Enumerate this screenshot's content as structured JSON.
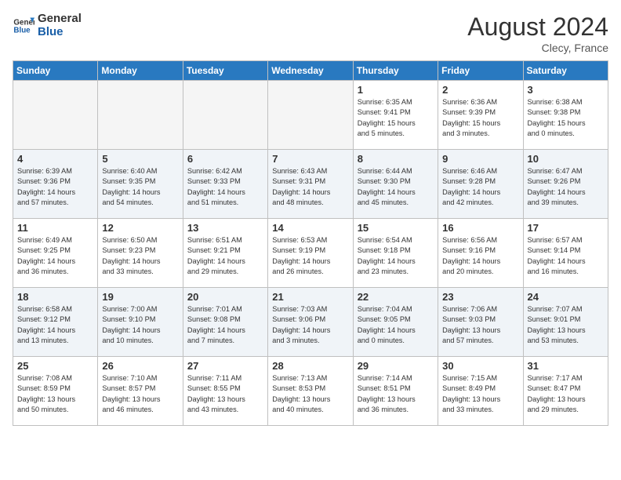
{
  "header": {
    "logo_line1": "General",
    "logo_line2": "Blue",
    "month_year": "August 2024",
    "location": "Clecy, France"
  },
  "weekdays": [
    "Sunday",
    "Monday",
    "Tuesday",
    "Wednesday",
    "Thursday",
    "Friday",
    "Saturday"
  ],
  "weeks": [
    [
      {
        "day": "",
        "info": ""
      },
      {
        "day": "",
        "info": ""
      },
      {
        "day": "",
        "info": ""
      },
      {
        "day": "",
        "info": ""
      },
      {
        "day": "1",
        "info": "Sunrise: 6:35 AM\nSunset: 9:41 PM\nDaylight: 15 hours\nand 5 minutes."
      },
      {
        "day": "2",
        "info": "Sunrise: 6:36 AM\nSunset: 9:39 PM\nDaylight: 15 hours\nand 3 minutes."
      },
      {
        "day": "3",
        "info": "Sunrise: 6:38 AM\nSunset: 9:38 PM\nDaylight: 15 hours\nand 0 minutes."
      }
    ],
    [
      {
        "day": "4",
        "info": "Sunrise: 6:39 AM\nSunset: 9:36 PM\nDaylight: 14 hours\nand 57 minutes."
      },
      {
        "day": "5",
        "info": "Sunrise: 6:40 AM\nSunset: 9:35 PM\nDaylight: 14 hours\nand 54 minutes."
      },
      {
        "day": "6",
        "info": "Sunrise: 6:42 AM\nSunset: 9:33 PM\nDaylight: 14 hours\nand 51 minutes."
      },
      {
        "day": "7",
        "info": "Sunrise: 6:43 AM\nSunset: 9:31 PM\nDaylight: 14 hours\nand 48 minutes."
      },
      {
        "day": "8",
        "info": "Sunrise: 6:44 AM\nSunset: 9:30 PM\nDaylight: 14 hours\nand 45 minutes."
      },
      {
        "day": "9",
        "info": "Sunrise: 6:46 AM\nSunset: 9:28 PM\nDaylight: 14 hours\nand 42 minutes."
      },
      {
        "day": "10",
        "info": "Sunrise: 6:47 AM\nSunset: 9:26 PM\nDaylight: 14 hours\nand 39 minutes."
      }
    ],
    [
      {
        "day": "11",
        "info": "Sunrise: 6:49 AM\nSunset: 9:25 PM\nDaylight: 14 hours\nand 36 minutes."
      },
      {
        "day": "12",
        "info": "Sunrise: 6:50 AM\nSunset: 9:23 PM\nDaylight: 14 hours\nand 33 minutes."
      },
      {
        "day": "13",
        "info": "Sunrise: 6:51 AM\nSunset: 9:21 PM\nDaylight: 14 hours\nand 29 minutes."
      },
      {
        "day": "14",
        "info": "Sunrise: 6:53 AM\nSunset: 9:19 PM\nDaylight: 14 hours\nand 26 minutes."
      },
      {
        "day": "15",
        "info": "Sunrise: 6:54 AM\nSunset: 9:18 PM\nDaylight: 14 hours\nand 23 minutes."
      },
      {
        "day": "16",
        "info": "Sunrise: 6:56 AM\nSunset: 9:16 PM\nDaylight: 14 hours\nand 20 minutes."
      },
      {
        "day": "17",
        "info": "Sunrise: 6:57 AM\nSunset: 9:14 PM\nDaylight: 14 hours\nand 16 minutes."
      }
    ],
    [
      {
        "day": "18",
        "info": "Sunrise: 6:58 AM\nSunset: 9:12 PM\nDaylight: 14 hours\nand 13 minutes."
      },
      {
        "day": "19",
        "info": "Sunrise: 7:00 AM\nSunset: 9:10 PM\nDaylight: 14 hours\nand 10 minutes."
      },
      {
        "day": "20",
        "info": "Sunrise: 7:01 AM\nSunset: 9:08 PM\nDaylight: 14 hours\nand 7 minutes."
      },
      {
        "day": "21",
        "info": "Sunrise: 7:03 AM\nSunset: 9:06 PM\nDaylight: 14 hours\nand 3 minutes."
      },
      {
        "day": "22",
        "info": "Sunrise: 7:04 AM\nSunset: 9:05 PM\nDaylight: 14 hours\nand 0 minutes."
      },
      {
        "day": "23",
        "info": "Sunrise: 7:06 AM\nSunset: 9:03 PM\nDaylight: 13 hours\nand 57 minutes."
      },
      {
        "day": "24",
        "info": "Sunrise: 7:07 AM\nSunset: 9:01 PM\nDaylight: 13 hours\nand 53 minutes."
      }
    ],
    [
      {
        "day": "25",
        "info": "Sunrise: 7:08 AM\nSunset: 8:59 PM\nDaylight: 13 hours\nand 50 minutes."
      },
      {
        "day": "26",
        "info": "Sunrise: 7:10 AM\nSunset: 8:57 PM\nDaylight: 13 hours\nand 46 minutes."
      },
      {
        "day": "27",
        "info": "Sunrise: 7:11 AM\nSunset: 8:55 PM\nDaylight: 13 hours\nand 43 minutes."
      },
      {
        "day": "28",
        "info": "Sunrise: 7:13 AM\nSunset: 8:53 PM\nDaylight: 13 hours\nand 40 minutes."
      },
      {
        "day": "29",
        "info": "Sunrise: 7:14 AM\nSunset: 8:51 PM\nDaylight: 13 hours\nand 36 minutes."
      },
      {
        "day": "30",
        "info": "Sunrise: 7:15 AM\nSunset: 8:49 PM\nDaylight: 13 hours\nand 33 minutes."
      },
      {
        "day": "31",
        "info": "Sunrise: 7:17 AM\nSunset: 8:47 PM\nDaylight: 13 hours\nand 29 minutes."
      }
    ]
  ]
}
